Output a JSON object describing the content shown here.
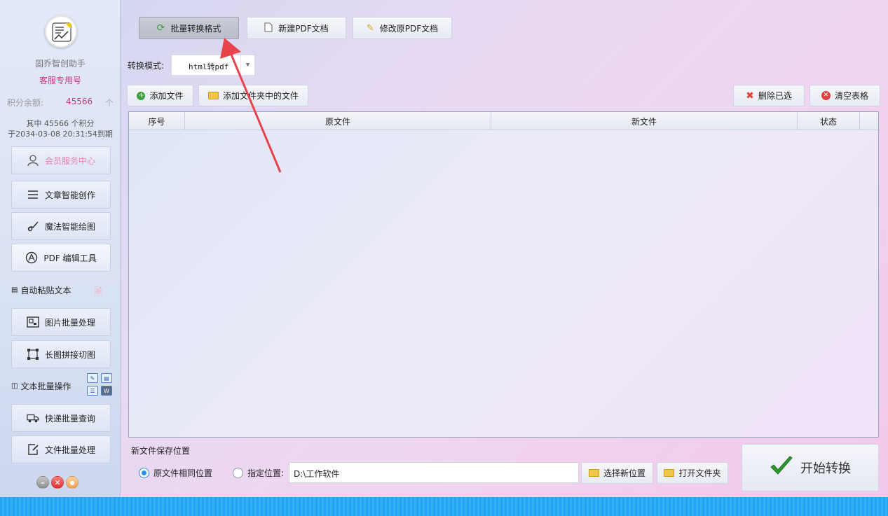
{
  "sidebar": {
    "app_name": "固乔智创助手",
    "account": "客服专用号",
    "points_label": "积分余额:",
    "points_value": "45566",
    "points_unit": "个",
    "points_detail_1": "其中 45566 个积分",
    "points_detail_2": "于2034-03-08 20:31:54到期",
    "menu": {
      "member": "会员服务中心",
      "article": "文章智能创作",
      "drawing": "魔法智能绘图",
      "pdf": "PDF 编辑工具",
      "autopaste": "自动粘贴文本",
      "image": "图片批量处理",
      "longimage": "长图拼接切图",
      "textbatch": "文本批量操作",
      "express": "快递批量查询",
      "filebatch": "文件批量处理"
    }
  },
  "top_tabs": {
    "batch_convert": "批量转换格式",
    "new_pdf": "新建PDF文档",
    "edit_pdf": "修改原PDF文档"
  },
  "mode": {
    "label": "转换模式:",
    "selected": "html转pdf"
  },
  "toolbar": {
    "add_file": "添加文件",
    "add_folder": "添加文件夹中的文件",
    "delete_selected": "删除已选",
    "clear_table": "清空表格"
  },
  "table": {
    "columns": [
      "序号",
      "原文件",
      "新文件",
      "状态"
    ],
    "rows": []
  },
  "save": {
    "section_label": "新文件保存位置",
    "option_same": "原文件相同位置",
    "option_custom": "指定位置:",
    "path_value": "D:\\工作软件",
    "choose_location": "选择新位置",
    "open_folder": "打开文件夹"
  },
  "start_button": "开始转换",
  "colors": {
    "accent_pink": "#c23b8a",
    "radio_blue": "#2a8ee8",
    "arrow_red": "#e8434b"
  }
}
